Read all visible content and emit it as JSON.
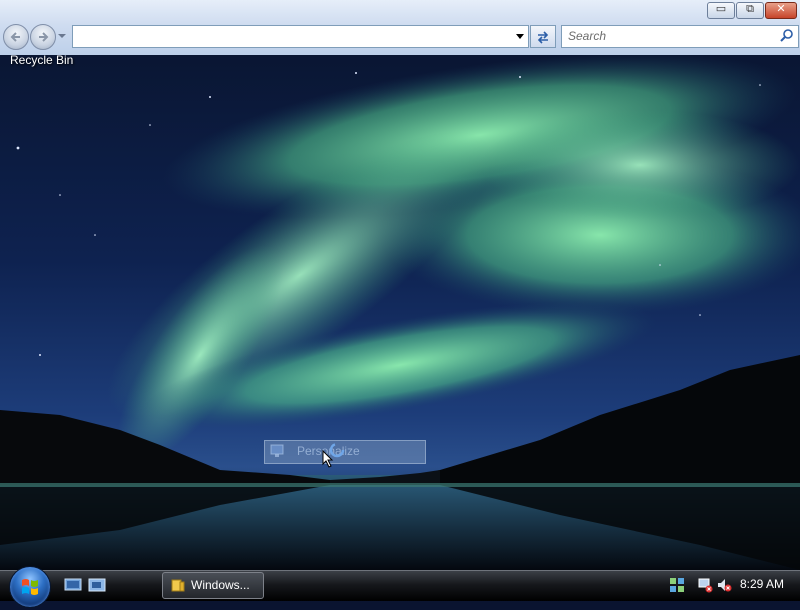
{
  "window": {
    "caption_buttons": {
      "minimize": "▭",
      "maximize": "⧉",
      "close": "✕"
    }
  },
  "toolbar": {
    "back_icon": "back-arrow-icon",
    "forward_icon": "forward-arrow-icon",
    "address_value": "",
    "refresh_icon": "refresh-icon",
    "search_placeholder": "Search",
    "search_icon": "magnifier-icon"
  },
  "desktop": {
    "recycle_bin_label": "Recycle Bin",
    "drag_ghost_label": "Personalize"
  },
  "taskbar": {
    "start_icon": "windows-start-orb",
    "quick_launch": [
      "show-desktop-icon",
      "switch-windows-icon"
    ],
    "tasks": [
      {
        "label": "Windows...",
        "icon": "folder-icon"
      }
    ],
    "tray_icons": [
      "network-icon",
      "network-error-icon",
      "volume-muted-icon"
    ],
    "clock": "8:29 AM"
  },
  "colors": {
    "aurora_green": "#7fe0a8",
    "sky_dark": "#0a1633",
    "taskbar_black": "#000000"
  }
}
